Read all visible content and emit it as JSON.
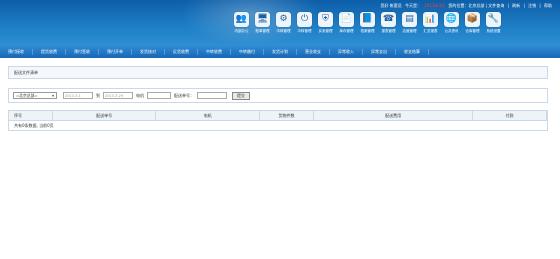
{
  "topbar": {
    "welcome": "您好 帐套员",
    "today": "今天是：",
    "date": "2013年3月",
    "location": "您的位置：北京总部 | 文件查询",
    "links": [
      "刷新",
      "注销",
      "帮助"
    ]
  },
  "toolbar": [
    {
      "icon": "users-icon",
      "glyph": "👥",
      "label": "内部办公"
    },
    {
      "icon": "monitor-icon",
      "glyph": "🖥",
      "label": "账单管理"
    },
    {
      "icon": "gear-icon",
      "glyph": "⚙",
      "label": "中转管理"
    },
    {
      "icon": "power-icon",
      "glyph": "⏻",
      "label": "中转管理"
    },
    {
      "icon": "shield-icon",
      "glyph": "⛨",
      "label": "买卖管理"
    },
    {
      "icon": "document-icon",
      "glyph": "📄",
      "label": "库存管理"
    },
    {
      "icon": "book-icon",
      "glyph": "📘",
      "label": "档案管理"
    },
    {
      "icon": "110-icon",
      "glyph": "☎",
      "label": "报表管理"
    },
    {
      "icon": "tray-icon",
      "glyph": "▤",
      "label": "店营管理"
    },
    {
      "icon": "chart-icon",
      "glyph": "📊",
      "label": "汇总报表"
    },
    {
      "icon": "globe-icon",
      "glyph": "🌐",
      "label": "公共资讯"
    },
    {
      "icon": "box-icon",
      "glyph": "📦",
      "label": "仓库管理"
    },
    {
      "icon": "settings-icon",
      "glyph": "🔧",
      "label": "系统设置"
    }
  ],
  "nav": [
    "预付接收",
    "提货收费",
    "预付签收",
    "预付开单",
    "发货核对",
    "反货收费",
    "中转收费",
    "中转缴付",
    "发货计划",
    "营业收支",
    "异常收入",
    "异常支出",
    "收支结算"
  ],
  "breadcrumb": "配送文件清单",
  "filter": {
    "select_value": "=北京总部=",
    "date_from": "2013-3-1",
    "date_to": "2013-3-29",
    "to_label": "到",
    "phone_label": "电机",
    "phone_value": "",
    "order_label": "配送单号：",
    "order_value": "",
    "submit": "提交"
  },
  "table": {
    "columns": [
      "序号",
      "配送单号",
      "电机",
      "货物件数",
      "配送费用",
      "付款"
    ],
    "empty_text": "共有0条数据, 当前0页"
  },
  "colors": {
    "header": "#1f7fc6",
    "nav": "#1667b5",
    "border": "#c9d9ea"
  }
}
